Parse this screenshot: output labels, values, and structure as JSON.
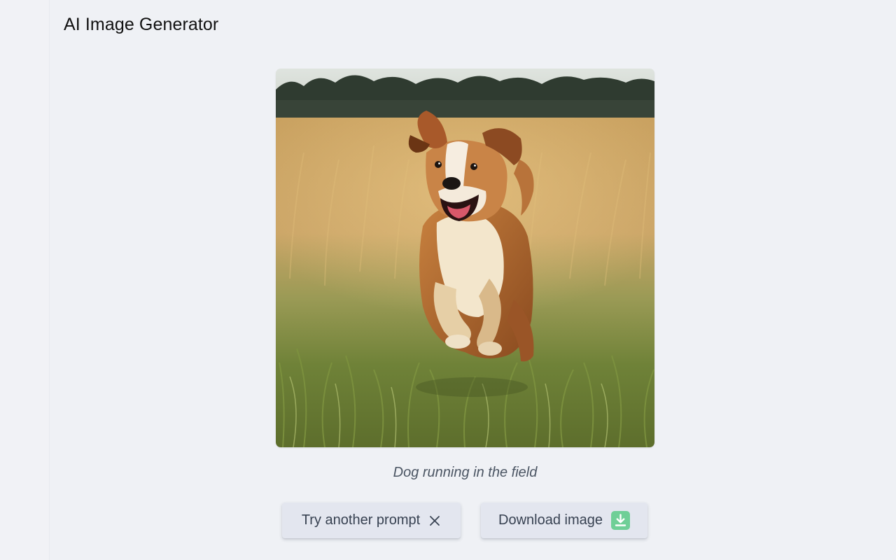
{
  "app": {
    "title": "AI Image Generator"
  },
  "result": {
    "image_alt": "Dog running in the field",
    "caption": "Dog running in the field"
  },
  "actions": {
    "retry_label": "Try another prompt",
    "retry_icon": "close-icon",
    "download_label": "Download image",
    "download_icon": "download-icon",
    "download_icon_color": "#6fcf97"
  }
}
